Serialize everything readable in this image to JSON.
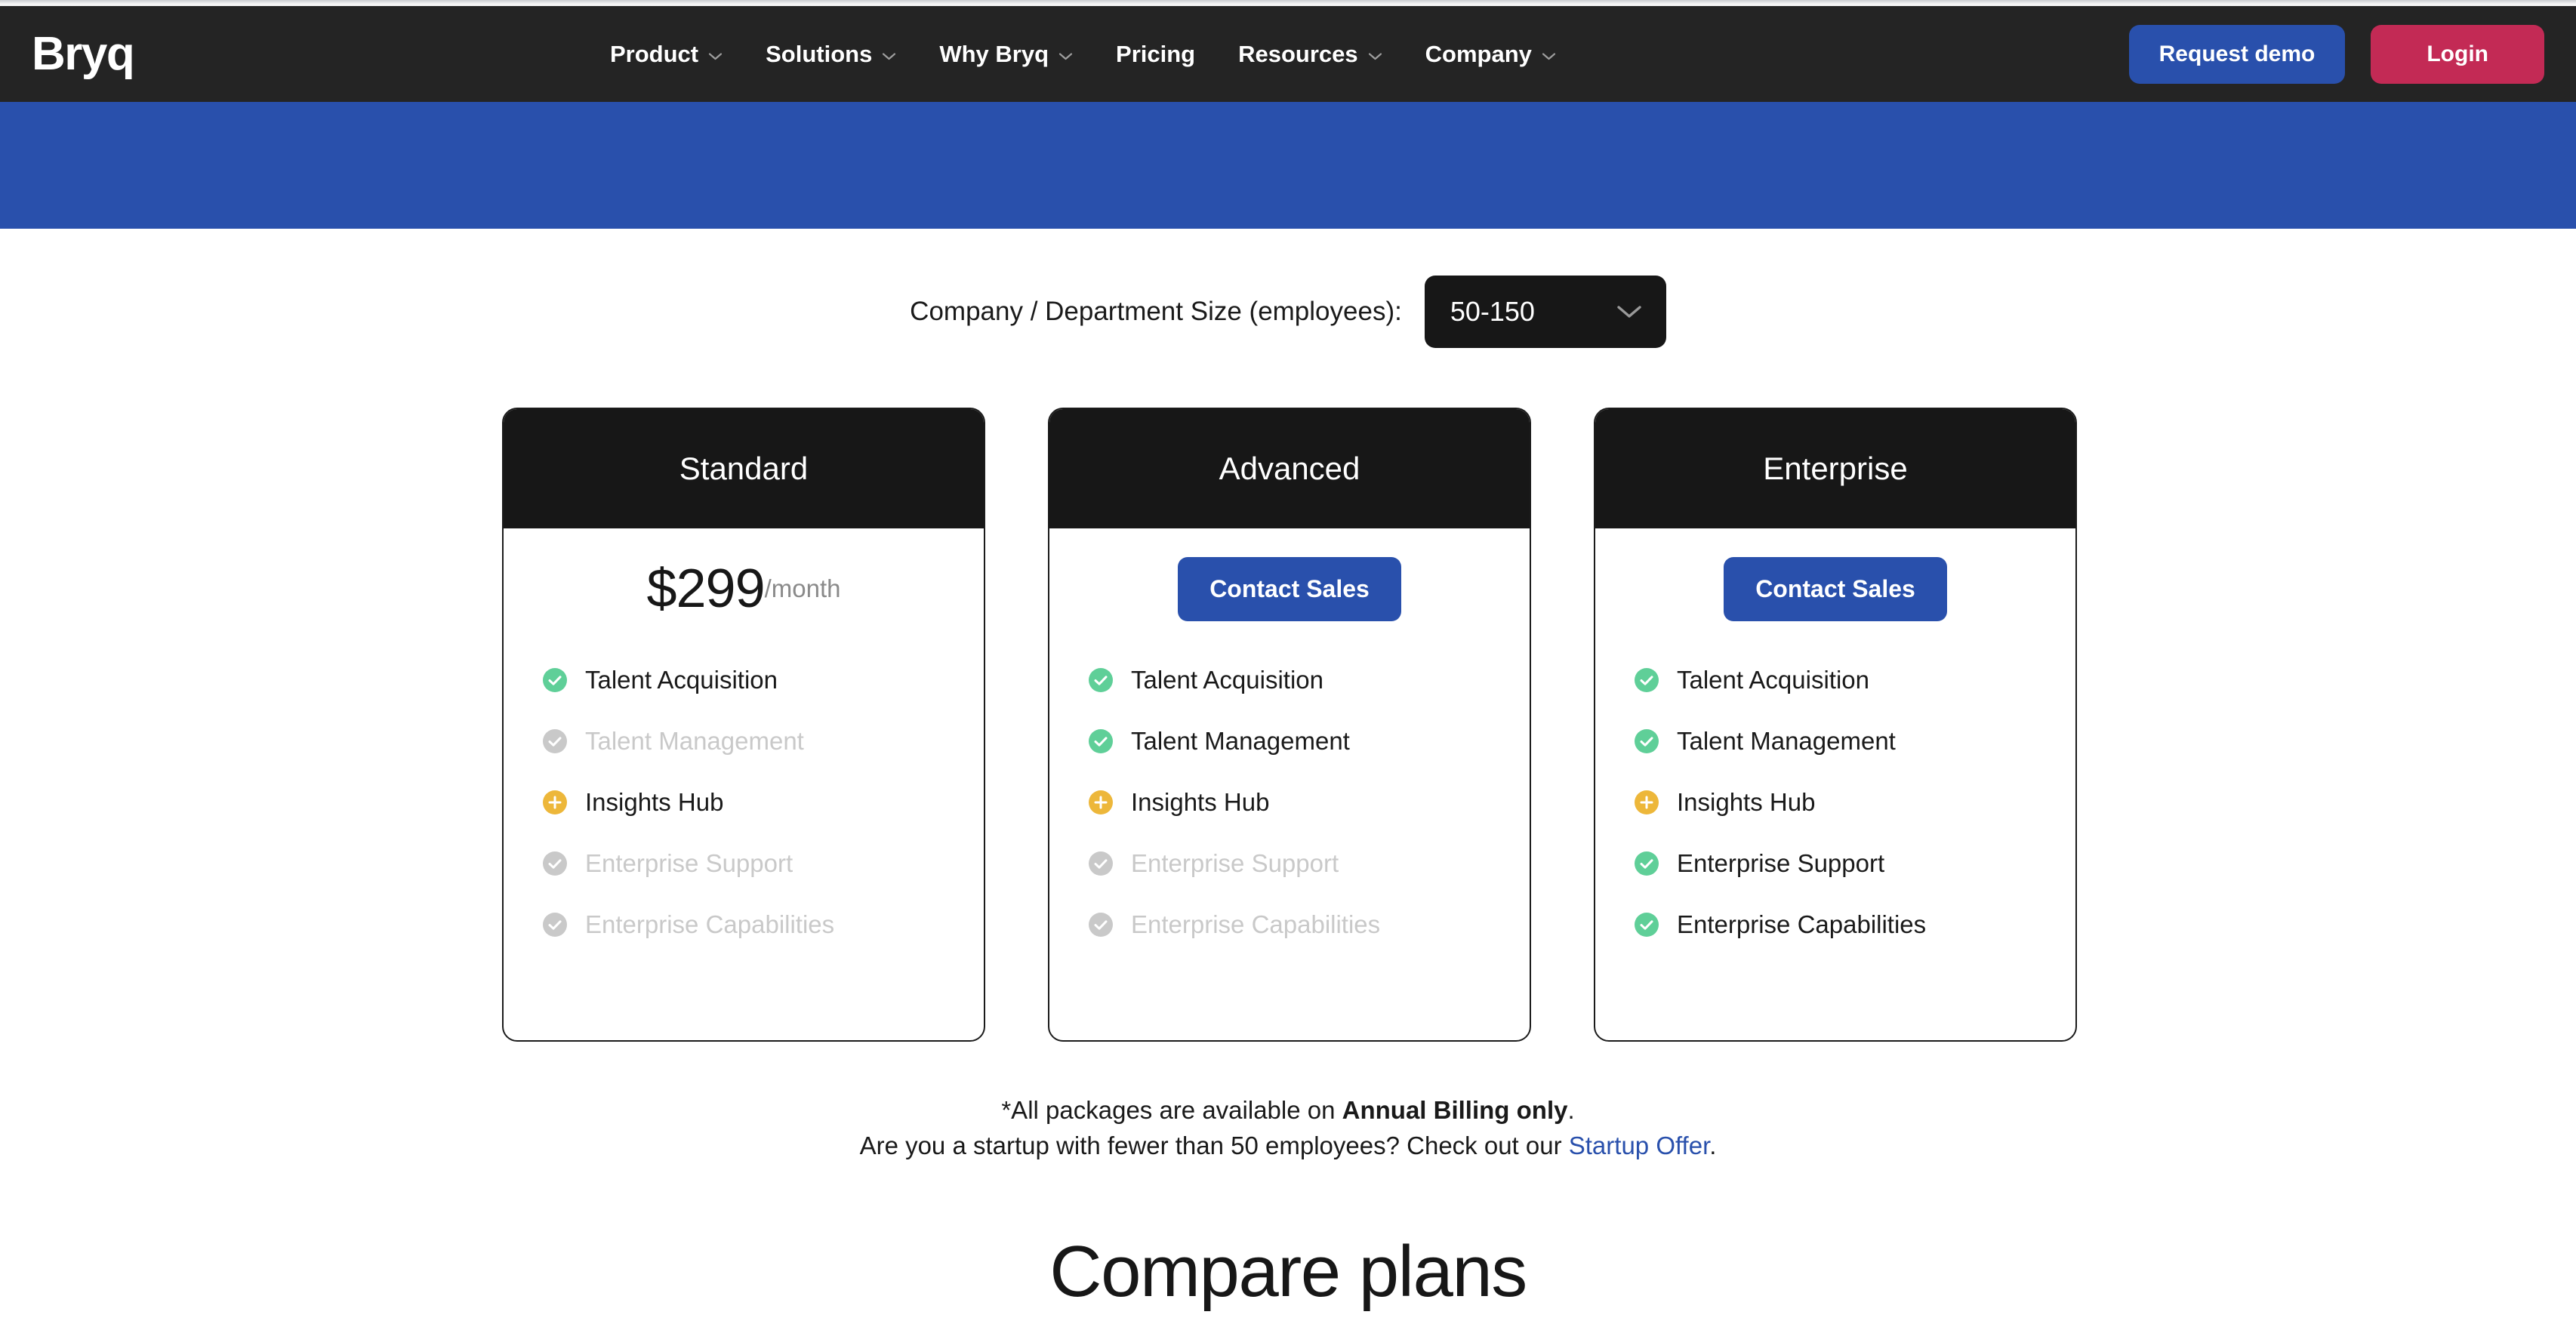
{
  "brand": {
    "logo_text": "Bryq",
    "accent_blue": "#2950ac",
    "accent_crimson": "#c32a55",
    "dark": "#171717",
    "green": "#5fcf98",
    "amber": "#edb73a",
    "muted": "#c9c9c9"
  },
  "header": {
    "nav": [
      {
        "label": "Product",
        "has_dropdown": true
      },
      {
        "label": "Solutions",
        "has_dropdown": true
      },
      {
        "label": "Why Bryq",
        "has_dropdown": true
      },
      {
        "label": "Pricing",
        "has_dropdown": false
      },
      {
        "label": "Resources",
        "has_dropdown": true
      },
      {
        "label": "Company",
        "has_dropdown": true
      }
    ],
    "request_demo_label": "Request demo",
    "login_label": "Login"
  },
  "selector": {
    "label": "Company / Department Size (employees):",
    "selected_value": "50-150"
  },
  "plans": [
    {
      "name": "Standard",
      "price_amount": "$299",
      "price_period": "/month",
      "cta_label": "",
      "has_price": true,
      "features": [
        {
          "label": "Talent Acquisition",
          "state": "included"
        },
        {
          "label": "Talent Management",
          "state": "excluded"
        },
        {
          "label": "Insights Hub",
          "state": "addon"
        },
        {
          "label": "Enterprise Support",
          "state": "excluded"
        },
        {
          "label": "Enterprise Capabilities",
          "state": "excluded"
        }
      ]
    },
    {
      "name": "Advanced",
      "price_amount": "",
      "price_period": "",
      "cta_label": "Contact Sales",
      "has_price": false,
      "features": [
        {
          "label": "Talent Acquisition",
          "state": "included"
        },
        {
          "label": "Talent Management",
          "state": "included"
        },
        {
          "label": "Insights Hub",
          "state": "addon"
        },
        {
          "label": "Enterprise Support",
          "state": "excluded"
        },
        {
          "label": "Enterprise Capabilities",
          "state": "excluded"
        }
      ]
    },
    {
      "name": "Enterprise",
      "price_amount": "",
      "price_period": "",
      "cta_label": "Contact Sales",
      "has_price": false,
      "features": [
        {
          "label": "Talent Acquisition",
          "state": "included"
        },
        {
          "label": "Talent Management",
          "state": "included"
        },
        {
          "label": "Insights Hub",
          "state": "addon"
        },
        {
          "label": "Enterprise Support",
          "state": "included"
        },
        {
          "label": "Enterprise Capabilities",
          "state": "included"
        }
      ]
    }
  ],
  "footnote": {
    "line1_prefix": "*All packages are available on ",
    "line1_bold": "Annual Billing only",
    "line1_suffix": ".",
    "line2_prefix": "Are you a startup with fewer than 50 employees? Check out our ",
    "line2_link": "Startup Offer",
    "line2_suffix": "."
  },
  "compare_heading": "Compare plans"
}
